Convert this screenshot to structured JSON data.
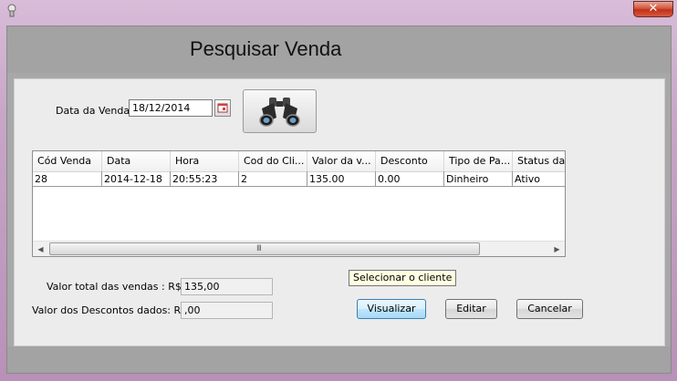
{
  "window": {
    "close_glyph": "✕"
  },
  "header": {
    "title": "Pesquisar Venda"
  },
  "search": {
    "date_label": "Data da Venda:",
    "date_value": "18/12/2014",
    "calendar_icon": "calendar-icon",
    "search_icon": "binoculars-icon"
  },
  "grid": {
    "columns": [
      "Cód Venda",
      "Data",
      "Hora",
      "Cod do Cli...",
      "Valor da v...",
      "Desconto",
      "Tipo de Pa...",
      "Status da ..."
    ],
    "rows": [
      [
        "28",
        "2014-12-18",
        "20:55:23",
        "2",
        "135.00",
        "0.00",
        "Dinheiro",
        "Ativo"
      ]
    ],
    "scroll_grip": "III"
  },
  "totals": {
    "total_label": "Valor total das vendas : R$",
    "total_value": "135,00",
    "discount_label": "Valor dos Descontos dados: R$:",
    "discount_value": ",00"
  },
  "actions": {
    "view_label": "Visualizar",
    "edit_label": "Editar",
    "cancel_label": "Cancelar"
  },
  "tooltip": "Selecionar o cliente"
}
